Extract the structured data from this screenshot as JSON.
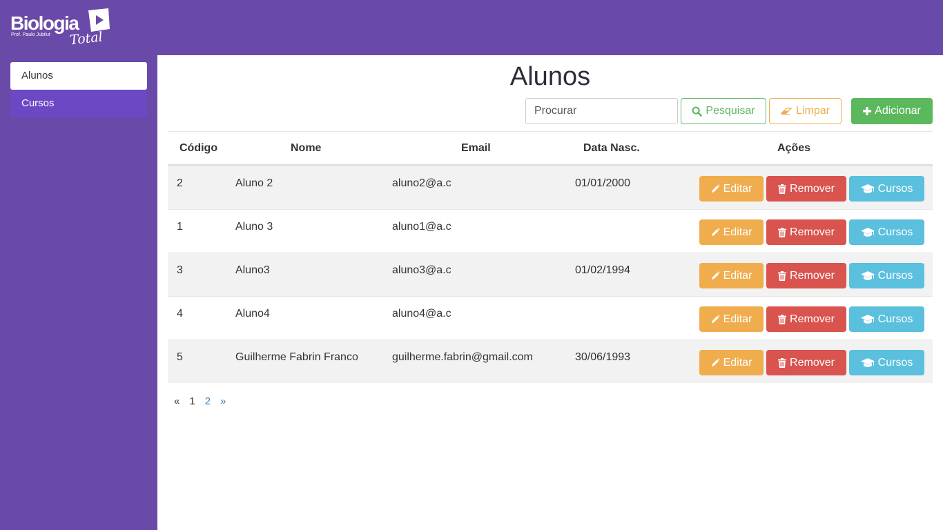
{
  "brand": {
    "name": "Biologia",
    "subtitle": "Prof. Paulo Jubilut",
    "total": "Total"
  },
  "sidebar": {
    "items": [
      {
        "label": "Alunos",
        "active": true
      },
      {
        "label": "Cursos",
        "active": false
      }
    ]
  },
  "page": {
    "title": "Alunos"
  },
  "toolbar": {
    "search_placeholder": "Procurar",
    "search_label": "Pesquisar",
    "clear_label": "Limpar",
    "add_label": "Adicionar"
  },
  "table": {
    "headers": {
      "code": "Código",
      "name": "Nome",
      "email": "Email",
      "birth": "Data Nasc.",
      "actions": "Ações"
    },
    "rows": [
      {
        "code": "2",
        "name": "Aluno 2",
        "email": "aluno2@a.c",
        "birth": "01/01/2000"
      },
      {
        "code": "1",
        "name": "Aluno 3",
        "email": "aluno1@a.c",
        "birth": ""
      },
      {
        "code": "3",
        "name": "Aluno3",
        "email": "aluno3@a.c",
        "birth": "01/02/1994"
      },
      {
        "code": "4",
        "name": "Aluno4",
        "email": "aluno4@a.c",
        "birth": ""
      },
      {
        "code": "5",
        "name": "Guilherme Fabrin Franco",
        "email": "guilherme.fabrin@gmail.com",
        "birth": "30/06/1993"
      }
    ],
    "actions": {
      "edit": "Editar",
      "remove": "Remover",
      "courses": "Cursos"
    }
  },
  "pagination": {
    "prev": "«",
    "pages": [
      "1",
      "2"
    ],
    "current": "1",
    "next": "»"
  },
  "colors": {
    "brand_purple": "#6a4aa8",
    "sidebar_item": "#6c48c4",
    "success": "#5cb85c",
    "warning": "#f0ad4e",
    "danger": "#d9534f",
    "info": "#5bc0de",
    "link": "#337ab7"
  },
  "icons": {
    "search": "search-icon",
    "clear": "eraser-icon",
    "add": "plus-icon",
    "edit": "pencil-icon",
    "remove": "trash-icon",
    "courses": "graduation-cap-icon",
    "play": "play-icon"
  }
}
